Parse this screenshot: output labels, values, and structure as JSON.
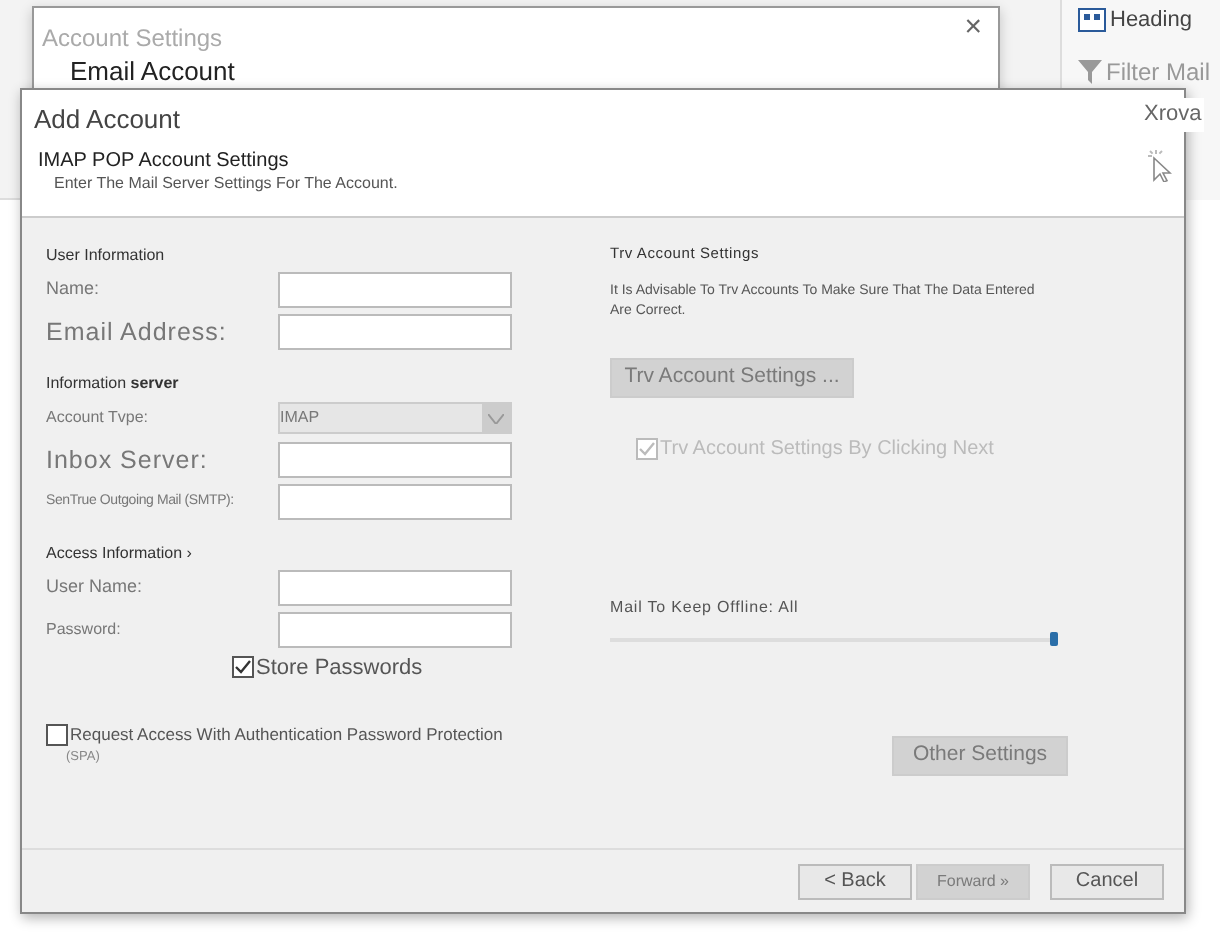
{
  "background_app": {
    "side_items": [
      {
        "kind": "heading",
        "label": "Heading"
      },
      {
        "kind": "filter",
        "label": "Filter Mail"
      }
    ],
    "search_hint": "Xrova"
  },
  "account_settings_window": {
    "title": "Account Settings",
    "close_label": "×",
    "heading": "Email Account"
  },
  "add_account_dialog": {
    "title": "Add Account",
    "header": {
      "title": "IMAP POP Account Settings",
      "subtitle": "Enter The Mail Server Settings For The Account."
    },
    "left_sections": [
      {
        "heading": "User Information",
        "fields": [
          {
            "label": "Name:",
            "kind": "input"
          },
          {
            "label": "Email Address:",
            "kind": "input"
          }
        ]
      },
      {
        "heading": "Information **server**",
        "fields": [
          {
            "label": "Account Tvpe:",
            "kind": "select",
            "value": "IMAP",
            "disabled": true
          },
          {
            "label": "Inbox Server:",
            "kind": "input"
          },
          {
            "label": "SenTrue Outgoing Mail (SMTP):",
            "kind": "input"
          }
        ]
      },
      {
        "heading": "Access Information ›",
        "fields": [
          {
            "label": "User Name:",
            "kind": "input"
          },
          {
            "label": "Password:",
            "kind": "input"
          }
        ]
      }
    ],
    "store_passwords": {
      "label": "Store Passwords",
      "checked": true
    },
    "spa": {
      "label": "Request Access With Authentication Password Protection",
      "note": "(SPA)",
      "checked": false
    },
    "test": {
      "heading": "Trv Account Settings",
      "text": "It Is Advisable To Trv Accounts To Make Sure That The Data Entered Are Correct.",
      "button": {
        "label": "Trv Account Settings ...",
        "disabled": true
      },
      "checkbox": {
        "label": "Trv Account Settings By Clicking Next",
        "checked": true,
        "disabled": true
      }
    },
    "offline": {
      "label": "Mail To Keep Offline: All",
      "level": 1
    },
    "other_settings": {
      "label": "Other Settings",
      "disabled": true
    },
    "buttons": [
      {
        "label": "< Back",
        "disabled": false
      },
      {
        "label": "Forward »",
        "disabled": true
      },
      {
        "label": "Cancel",
        "disabled": false
      }
    ]
  }
}
